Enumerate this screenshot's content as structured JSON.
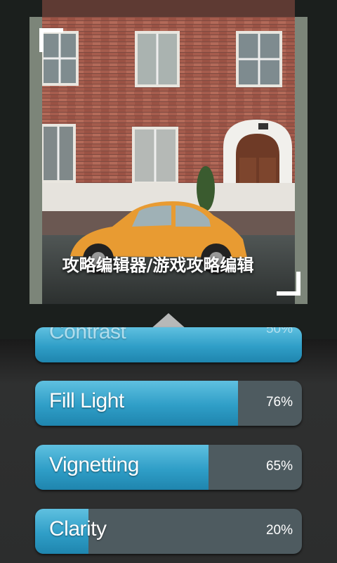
{
  "overlay_title": "攻略编辑器/游戏攻略编辑",
  "sliders": [
    {
      "label": "Contrast",
      "value": "50%",
      "level": 1.0
    },
    {
      "label": "Fill Light",
      "value": "76%",
      "level": 0.76
    },
    {
      "label": "Vignetting",
      "value": "65%",
      "level": 0.65
    },
    {
      "label": "Clarity",
      "value": "20%",
      "level": 0.2
    }
  ],
  "icons": {
    "collapse": "triangle-up-icon"
  },
  "colors": {
    "accent": "#2f9ec7",
    "track": "#4e5b60"
  }
}
